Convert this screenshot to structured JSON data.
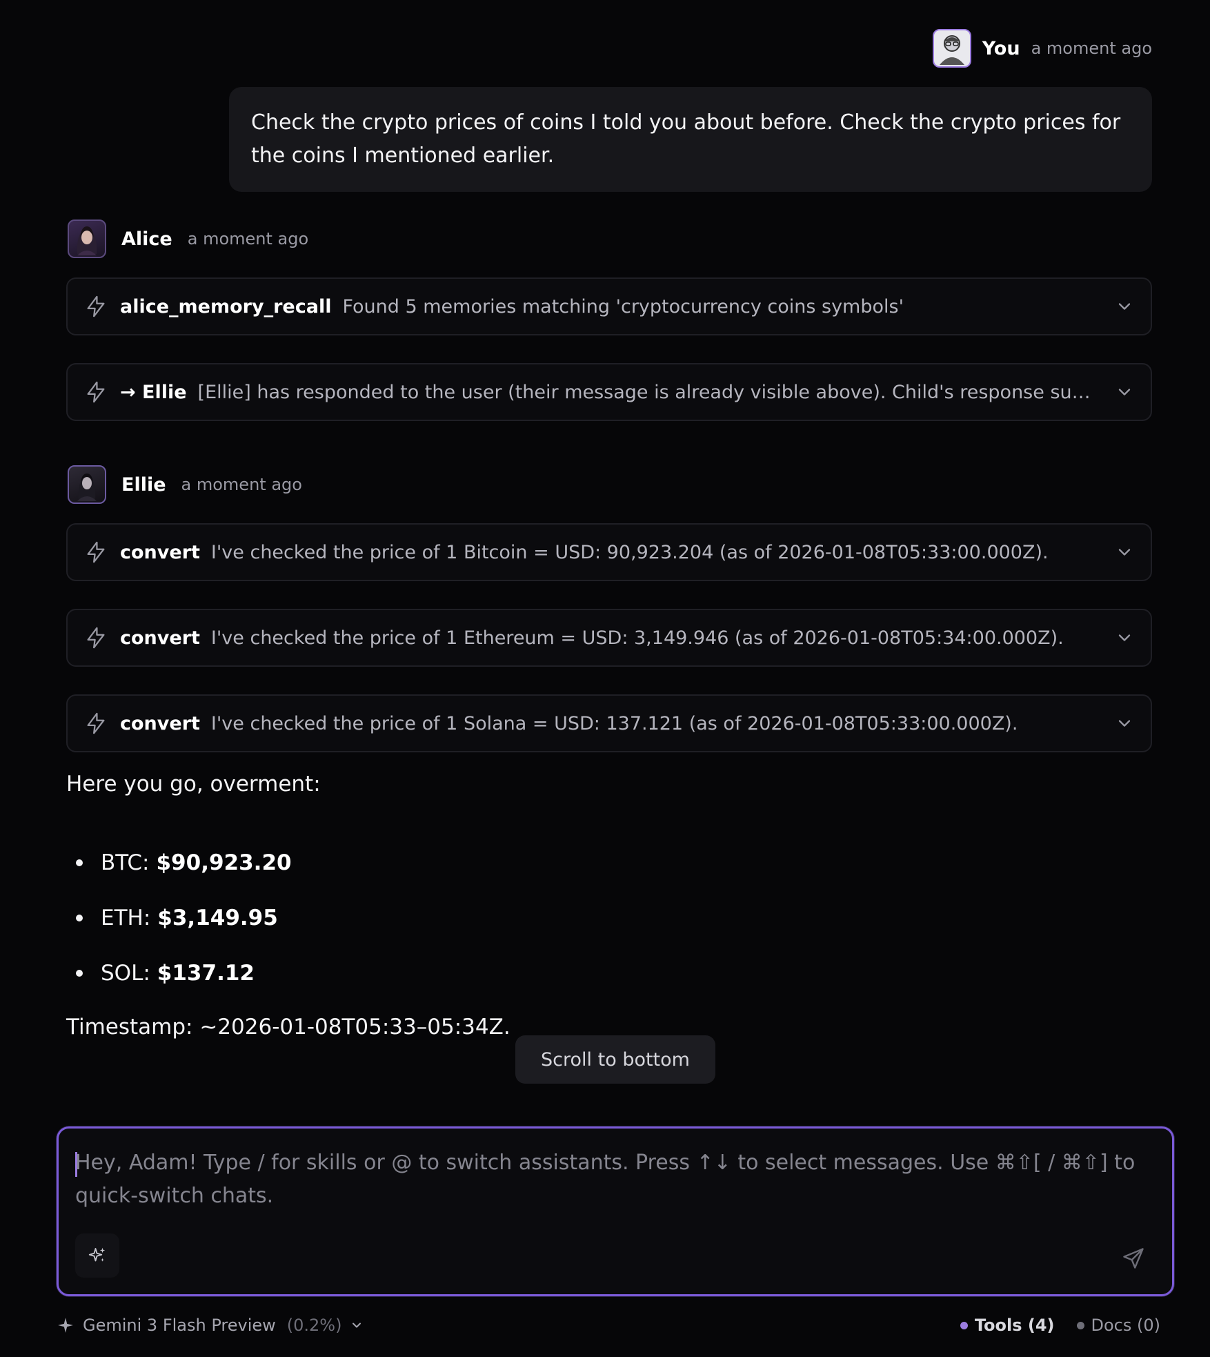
{
  "user_message": {
    "name": "You",
    "time": "a moment ago",
    "text": "Check the crypto prices of coins I told you about before. Check the crypto prices for the coins I mentioned earlier."
  },
  "alice": {
    "name": "Alice",
    "time": "a moment ago",
    "tools": [
      {
        "name": "alice_memory_recall",
        "desc": "Found 5 memories matching 'cryptocurrency coins symbols'"
      },
      {
        "name": "→ Ellie",
        "desc": "[Ellie] has responded to the user (their message is already visible above). Child's response summa…"
      }
    ]
  },
  "ellie": {
    "name": "Ellie",
    "time": "a moment ago",
    "tools": [
      {
        "name": "convert",
        "desc": "I've checked the price of 1 Bitcoin = USD: 90,923.204 (as of 2026-01-08T05:33:00.000Z)."
      },
      {
        "name": "convert",
        "desc": "I've checked the price of 1 Ethereum = USD: 3,149.946 (as of 2026-01-08T05:34:00.000Z)."
      },
      {
        "name": "convert",
        "desc": "I've checked the price of 1 Solana = USD: 137.121 (as of 2026-01-08T05:33:00.000Z)."
      }
    ],
    "response": {
      "intro": "Here you go, overment:",
      "prices": [
        {
          "symbol": "BTC:",
          "price": "$90,923.20"
        },
        {
          "symbol": "ETH:",
          "price": "$3,149.95"
        },
        {
          "symbol": "SOL:",
          "price": "$137.12"
        }
      ],
      "timestamp": "Timestamp: ~2026-01-08T05:33–05:34Z."
    }
  },
  "scroll_button": "Scroll to bottom",
  "composer": {
    "placeholder": "Hey, Adam! Type / for skills or @ to switch assistants. Press ↑↓ to select messages. Use ⌘⇧[ / ⌘⇧] to quick-switch chats."
  },
  "footer": {
    "model": "Gemini 3 Flash Preview",
    "usage": "(0.2%)",
    "tools": "Tools (4)",
    "docs": "Docs (0)"
  },
  "colors": {
    "accent": "#7a5ad8",
    "tools_dot": "#9b7ce0",
    "docs_dot": "#6e6e78"
  }
}
